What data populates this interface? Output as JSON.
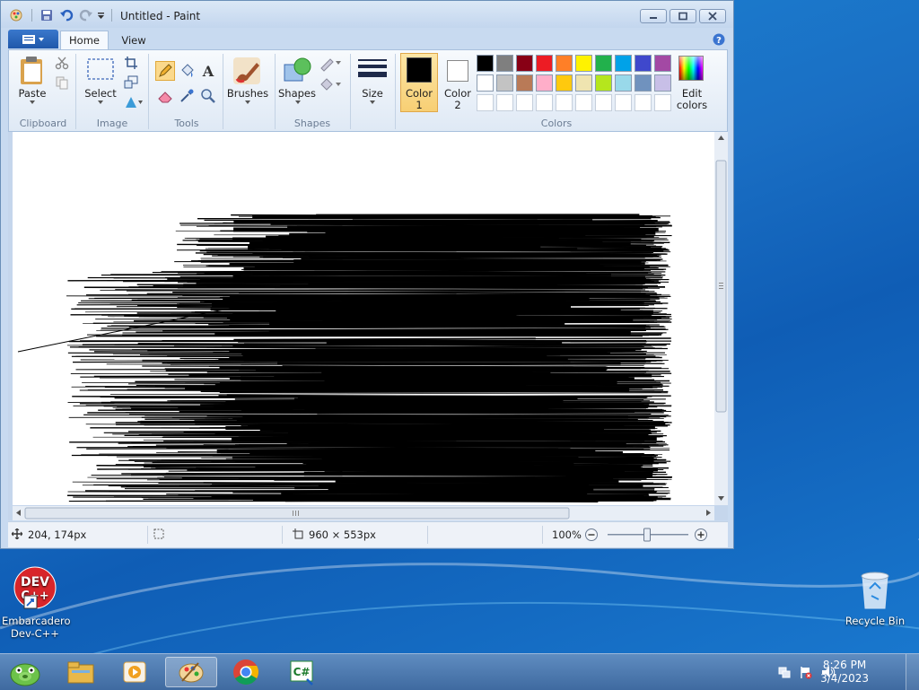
{
  "window": {
    "title": "Untitled - Paint",
    "tabs": [
      "Home",
      "View"
    ]
  },
  "ribbon": {
    "clipboard": {
      "paste": "Paste",
      "group": "Clipboard"
    },
    "image": {
      "select": "Select",
      "group": "Image"
    },
    "tools": {
      "group": "Tools"
    },
    "brushes": {
      "label": "Brushes"
    },
    "shapes": {
      "label": "Shapes",
      "group": "Shapes"
    },
    "size": {
      "label": "Size"
    },
    "color1": {
      "line1": "Color",
      "line2": "1",
      "value": "#000000"
    },
    "color2": {
      "line1": "Color",
      "line2": "2",
      "value": "#ffffff"
    },
    "colors_group": "Colors",
    "edit_colors": {
      "line1": "Edit",
      "line2": "colors"
    },
    "palette_row1": [
      "#000000",
      "#7f7f7f",
      "#880015",
      "#ed1c24",
      "#ff7f27",
      "#fff200",
      "#22b14c",
      "#00a2e8",
      "#3f48cc",
      "#a349a4"
    ],
    "palette_row2": [
      "#ffffff",
      "#c3c3c3",
      "#b97a57",
      "#ffaec9",
      "#ffc90e",
      "#efe4b0",
      "#b5e61d",
      "#99d9ea",
      "#7092be",
      "#c8bfe7"
    ],
    "palette_row3": [
      "#ffffff",
      "#ffffff",
      "#ffffff",
      "#ffffff",
      "#ffffff",
      "#ffffff",
      "#ffffff",
      "#ffffff",
      "#ffffff",
      "#ffffff"
    ]
  },
  "statusbar": {
    "cursor_pos": "204, 174px",
    "canvas_size": "960 × 553px",
    "zoom": "100%",
    "zoom_level": 1.0
  },
  "desktop": {
    "icons": [
      {
        "name": "devcpp",
        "line1": "Embarcadero",
        "line2": "Dev-C++"
      },
      {
        "name": "recycle-bin",
        "line1": "Recycle Bin",
        "line2": ""
      }
    ]
  },
  "taskbar": {
    "time": "8:26 PM",
    "date": "3/4/2023"
  }
}
